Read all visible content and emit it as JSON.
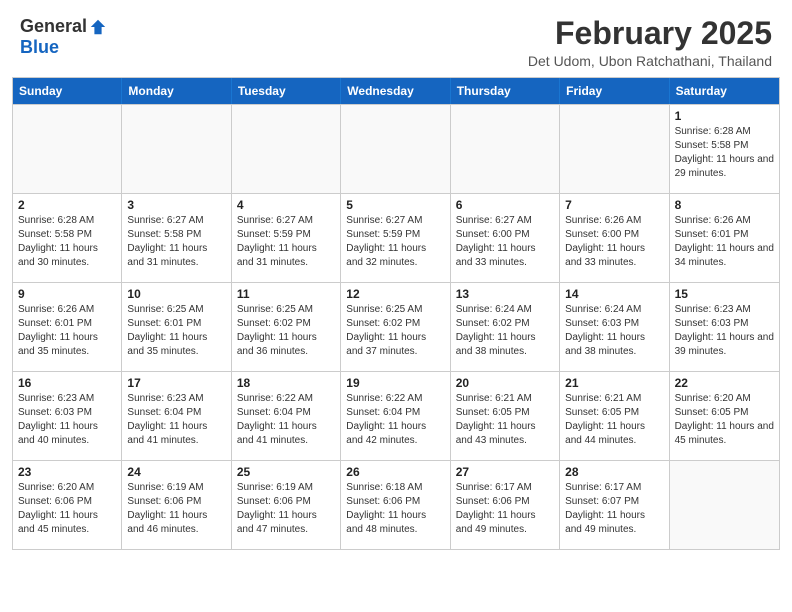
{
  "header": {
    "logo_general": "General",
    "logo_blue": "Blue",
    "month_title": "February 2025",
    "location": "Det Udom, Ubon Ratchathani, Thailand"
  },
  "weekdays": [
    "Sunday",
    "Monday",
    "Tuesday",
    "Wednesday",
    "Thursday",
    "Friday",
    "Saturday"
  ],
  "weeks": [
    [
      {
        "day": "",
        "empty": true
      },
      {
        "day": "",
        "empty": true
      },
      {
        "day": "",
        "empty": true
      },
      {
        "day": "",
        "empty": true
      },
      {
        "day": "",
        "empty": true
      },
      {
        "day": "",
        "empty": true
      },
      {
        "day": "1",
        "sunrise": "6:28 AM",
        "sunset": "5:58 PM",
        "daylight": "11 hours and 29 minutes."
      }
    ],
    [
      {
        "day": "2",
        "sunrise": "6:28 AM",
        "sunset": "5:58 PM",
        "daylight": "11 hours and 30 minutes."
      },
      {
        "day": "3",
        "sunrise": "6:27 AM",
        "sunset": "5:58 PM",
        "daylight": "11 hours and 31 minutes."
      },
      {
        "day": "4",
        "sunrise": "6:27 AM",
        "sunset": "5:59 PM",
        "daylight": "11 hours and 31 minutes."
      },
      {
        "day": "5",
        "sunrise": "6:27 AM",
        "sunset": "5:59 PM",
        "daylight": "11 hours and 32 minutes."
      },
      {
        "day": "6",
        "sunrise": "6:27 AM",
        "sunset": "6:00 PM",
        "daylight": "11 hours and 33 minutes."
      },
      {
        "day": "7",
        "sunrise": "6:26 AM",
        "sunset": "6:00 PM",
        "daylight": "11 hours and 33 minutes."
      },
      {
        "day": "8",
        "sunrise": "6:26 AM",
        "sunset": "6:01 PM",
        "daylight": "11 hours and 34 minutes."
      }
    ],
    [
      {
        "day": "9",
        "sunrise": "6:26 AM",
        "sunset": "6:01 PM",
        "daylight": "11 hours and 35 minutes."
      },
      {
        "day": "10",
        "sunrise": "6:25 AM",
        "sunset": "6:01 PM",
        "daylight": "11 hours and 35 minutes."
      },
      {
        "day": "11",
        "sunrise": "6:25 AM",
        "sunset": "6:02 PM",
        "daylight": "11 hours and 36 minutes."
      },
      {
        "day": "12",
        "sunrise": "6:25 AM",
        "sunset": "6:02 PM",
        "daylight": "11 hours and 37 minutes."
      },
      {
        "day": "13",
        "sunrise": "6:24 AM",
        "sunset": "6:02 PM",
        "daylight": "11 hours and 38 minutes."
      },
      {
        "day": "14",
        "sunrise": "6:24 AM",
        "sunset": "6:03 PM",
        "daylight": "11 hours and 38 minutes."
      },
      {
        "day": "15",
        "sunrise": "6:23 AM",
        "sunset": "6:03 PM",
        "daylight": "11 hours and 39 minutes."
      }
    ],
    [
      {
        "day": "16",
        "sunrise": "6:23 AM",
        "sunset": "6:03 PM",
        "daylight": "11 hours and 40 minutes."
      },
      {
        "day": "17",
        "sunrise": "6:23 AM",
        "sunset": "6:04 PM",
        "daylight": "11 hours and 41 minutes."
      },
      {
        "day": "18",
        "sunrise": "6:22 AM",
        "sunset": "6:04 PM",
        "daylight": "11 hours and 41 minutes."
      },
      {
        "day": "19",
        "sunrise": "6:22 AM",
        "sunset": "6:04 PM",
        "daylight": "11 hours and 42 minutes."
      },
      {
        "day": "20",
        "sunrise": "6:21 AM",
        "sunset": "6:05 PM",
        "daylight": "11 hours and 43 minutes."
      },
      {
        "day": "21",
        "sunrise": "6:21 AM",
        "sunset": "6:05 PM",
        "daylight": "11 hours and 44 minutes."
      },
      {
        "day": "22",
        "sunrise": "6:20 AM",
        "sunset": "6:05 PM",
        "daylight": "11 hours and 45 minutes."
      }
    ],
    [
      {
        "day": "23",
        "sunrise": "6:20 AM",
        "sunset": "6:06 PM",
        "daylight": "11 hours and 45 minutes."
      },
      {
        "day": "24",
        "sunrise": "6:19 AM",
        "sunset": "6:06 PM",
        "daylight": "11 hours and 46 minutes."
      },
      {
        "day": "25",
        "sunrise": "6:19 AM",
        "sunset": "6:06 PM",
        "daylight": "11 hours and 47 minutes."
      },
      {
        "day": "26",
        "sunrise": "6:18 AM",
        "sunset": "6:06 PM",
        "daylight": "11 hours and 48 minutes."
      },
      {
        "day": "27",
        "sunrise": "6:17 AM",
        "sunset": "6:06 PM",
        "daylight": "11 hours and 49 minutes."
      },
      {
        "day": "28",
        "sunrise": "6:17 AM",
        "sunset": "6:07 PM",
        "daylight": "11 hours and 49 minutes."
      },
      {
        "day": "",
        "empty": true
      }
    ]
  ],
  "labels": {
    "sunrise_prefix": "Sunrise: ",
    "sunset_prefix": "Sunset: ",
    "daylight_prefix": "Daylight: "
  }
}
